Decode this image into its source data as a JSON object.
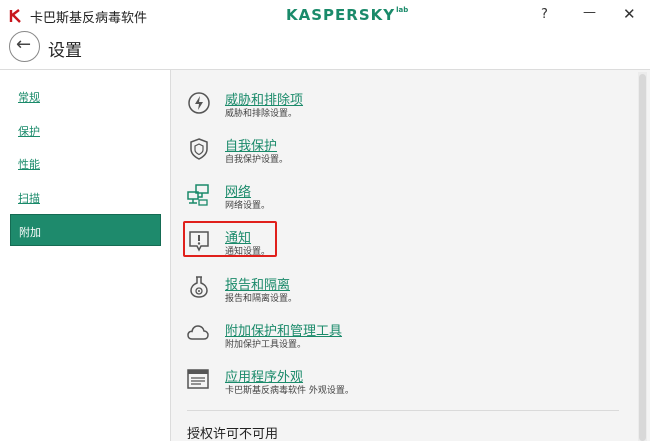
{
  "window": {
    "title": "卡巴斯基反病毒软件",
    "brand": "KASPERSKY",
    "brand_suffix": "lab",
    "help_glyph": "?",
    "minimize_glyph": "—",
    "close_glyph": "✕"
  },
  "header": {
    "title": "设置",
    "back_glyph": "←"
  },
  "sidebar": {
    "items": [
      {
        "label": "常规"
      },
      {
        "label": "保护"
      },
      {
        "label": "性能"
      },
      {
        "label": "扫描"
      },
      {
        "label": "附加"
      }
    ],
    "active": "附加"
  },
  "main": {
    "items": [
      {
        "title": "威胁和排除项",
        "desc": "威胁和排除设置。",
        "icon": "lightning-icon"
      },
      {
        "title": "自我保护",
        "desc": "自我保护设置。",
        "icon": "shield-icon"
      },
      {
        "title": "网络",
        "desc": "网络设置。",
        "icon": "network-icon"
      },
      {
        "title": "通知",
        "desc": "通知设置。",
        "icon": "notification-icon"
      },
      {
        "title": "报告和隔离",
        "desc": "报告和隔离设置。",
        "icon": "flask-icon"
      },
      {
        "title": "附加保护和管理工具",
        "desc": "附加保护工具设置。",
        "icon": "cloud-icon"
      },
      {
        "title": "应用程序外观",
        "desc": "卡巴斯基反病毒软件 外观设置。",
        "icon": "window-icon"
      }
    ],
    "license": "授权许可不可用"
  },
  "colors": {
    "accent": "#1a8a6a",
    "active_bg": "#1e8a6c",
    "highlight": "#e0201b"
  }
}
